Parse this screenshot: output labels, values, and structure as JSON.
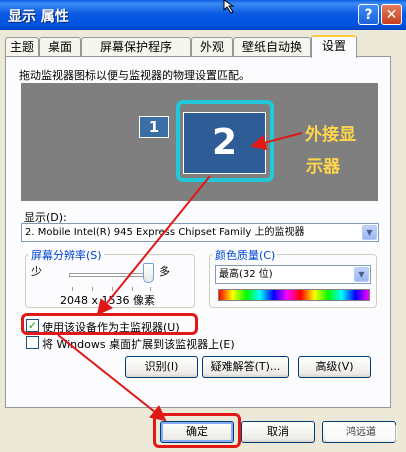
{
  "window": {
    "title": "显示 属性"
  },
  "titlebar": {
    "help_label": "?",
    "close_label": "✕"
  },
  "tabs": [
    {
      "label": "主题",
      "active": false
    },
    {
      "label": "桌面",
      "active": false
    },
    {
      "label": "屏幕保护程序",
      "active": false
    },
    {
      "label": "外观",
      "active": false
    },
    {
      "label": "壁纸自动换",
      "active": false
    },
    {
      "label": "设置",
      "active": true
    }
  ],
  "settings": {
    "description": "拖动监视器图标以便与监视器的物理设置匹配。",
    "monitor_1_label": "1",
    "monitor_2_label": "2",
    "annotation_line1": "外接显",
    "annotation_line2": "示器",
    "display_label": "显示(D):",
    "display_value": "2. Mobile Intel(R) 945 Express Chipset Family 上的监视器",
    "resolution": {
      "title": "屏幕分辨率(S)",
      "less_label": "少",
      "more_label": "多",
      "value": "2048 x 1536 像素",
      "slider_level": 1.0
    },
    "color_quality": {
      "title": "颜色质量(C)",
      "selected": "最高(32 位)"
    },
    "primary_checkbox": {
      "label": "使用该设备作为主监视器(U)",
      "checked": true
    },
    "extend_checkbox": {
      "label": "将 Windows 桌面扩展到该监视器上(E)",
      "checked": false
    },
    "buttons": {
      "identify": "识别(I)",
      "troubleshoot": "疑难解答(T)...",
      "advanced": "高级(V)"
    }
  },
  "footer": {
    "ok": "确定",
    "cancel": "取消",
    "watermark": "鸿远道"
  },
  "colors": {
    "titlebar": "#0054E3",
    "highlight_box": "#E01818",
    "monitor_frame": "#22C8D8",
    "annotation": "#FFD64A"
  }
}
